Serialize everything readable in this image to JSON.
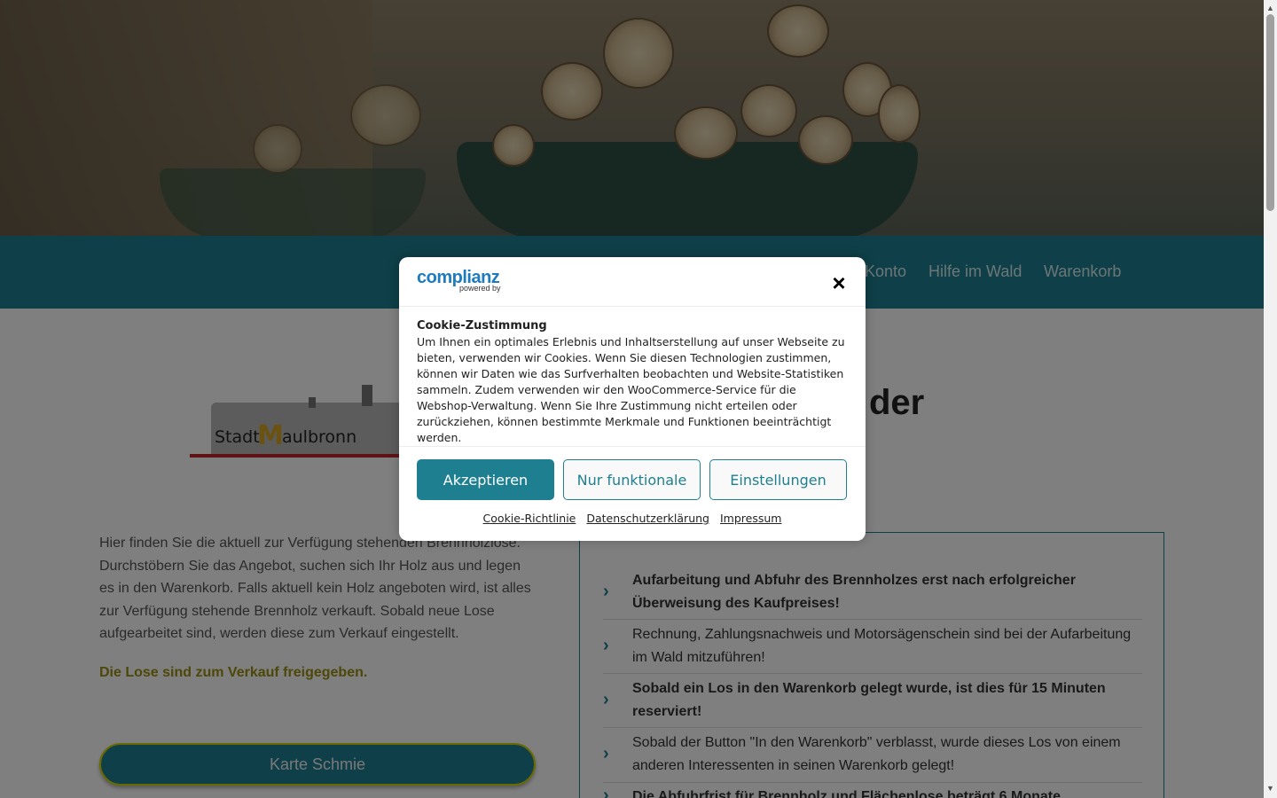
{
  "nav": {
    "items": [
      "Konto",
      "Hilfe im Wald",
      "Warenkorb"
    ]
  },
  "logo": {
    "stadt": "Stadt",
    "m": "M",
    "rest": "aulbronn"
  },
  "heading_partial": "der",
  "intro": "Hier finden Sie die aktuell zur Verfügung stehenden Brennholzlose. Durchstöbern Sie das Angebot, suchen sich Ihr Holz aus und legen es in den Warenkorb. Falls aktuell kein Holz angeboten wird, ist alles zur Verfügung stehende Brennholz verkauft. Sobald neue Lose aufgearbeitet sind, werden diese zum Verkauf eingestellt.",
  "notice": "Die Lose sind zum Verkauf freigegeben.",
  "map_button": "Karte Schmie",
  "rules": [
    {
      "text": "Aufarbeitung und Abfuhr des Brennholzes erst nach erfolgreicher Überweisung des Kaufpreises!",
      "bold": true
    },
    {
      "text": "Rechnung, Zahlungsnachweis und Motorsägenschein sind bei der Aufarbeitung im Wald mitzuführen!",
      "bold": false
    },
    {
      "text": "Sobald ein Los in den Warenkorb gelegt wurde, ist dies für 15 Minuten reserviert!",
      "bold": true
    },
    {
      "text": "Sobald der Button \"In den Warenkorb\" verblasst, wurde dieses Los von einem anderen Interessenten in seinen Warenkorb gelegt!",
      "bold": false
    },
    {
      "text": "Die Abfuhrfrist für Brennholz und Flächenlose beträgt 6 Monate",
      "bold": true
    }
  ],
  "cookie": {
    "brand": "complianz",
    "brand_sub": "powered by",
    "close": "×",
    "title": "Cookie-Zustimmung",
    "body": "Um Ihnen ein optimales Erlebnis und Inhaltserstellung auf unser Webseite zu bieten, verwenden wir Cookies. Wenn Sie diesen Technologien zustimmen, können wir Daten wie das Surfverhalten beobachten und Website-Statistiken sammeln. Zudem verwenden wir den WooCommerce-Service für die Webshop-Verwaltung. Wenn Sie Ihre Zustimmung nicht erteilen oder zurückziehen, können bestimmte Merkmale und Funktionen beeinträchtigt werden.",
    "accept": "Akzeptieren",
    "functional": "Nur funktionale",
    "settings": "Einstellungen",
    "links": [
      "Cookie-Richtlinie",
      "Datenschutzerklärung",
      "Impressum"
    ]
  },
  "colors": {
    "brand_teal": "#1e7f91",
    "notice_olive": "#9a8f10",
    "complianz_blue": "#1e7bbf"
  }
}
